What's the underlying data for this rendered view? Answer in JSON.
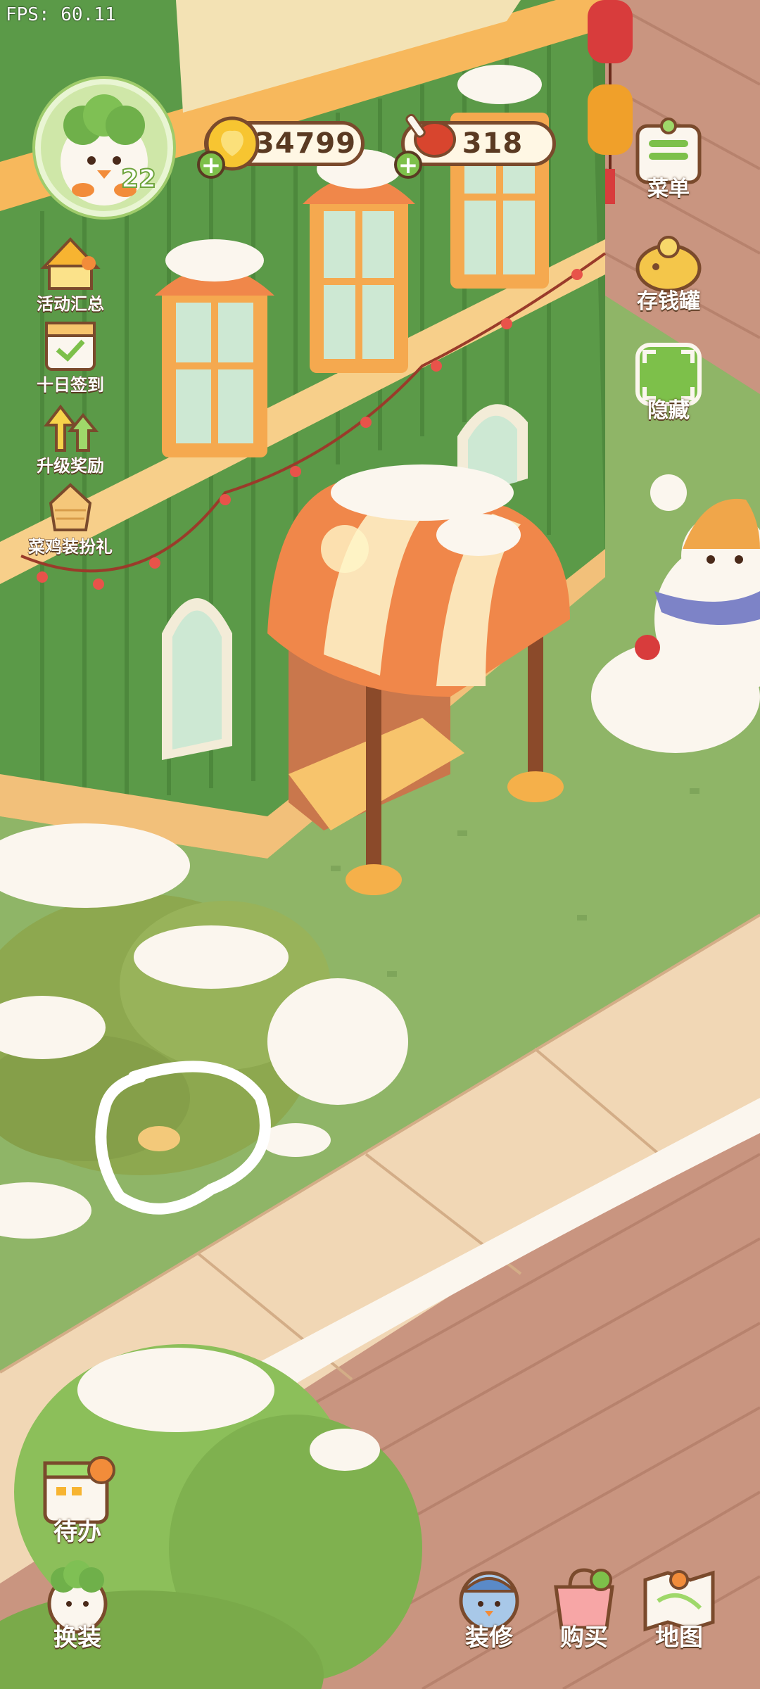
{
  "fps": "FPS: 60.11",
  "player": {
    "level": "22"
  },
  "resources": {
    "coins": "34799",
    "meat": "318"
  },
  "left_menu": [
    {
      "label": "活动汇总",
      "icon": "event-summary-icon"
    },
    {
      "label": "十日签到",
      "icon": "ten-day-checkin-icon"
    },
    {
      "label": "升级奖励",
      "icon": "level-up-reward-icon"
    },
    {
      "label": "菜鸡装扮礼",
      "icon": "dress-up-gift-icon"
    }
  ],
  "right_menu": [
    {
      "label": "菜单",
      "icon": "menu-list-icon"
    },
    {
      "label": "存钱罐",
      "icon": "piggy-bank-icon"
    },
    {
      "label": "隐藏",
      "icon": "hide-ui-icon"
    }
  ],
  "bottom_left": [
    {
      "label": "待办",
      "icon": "todo-calendar-icon"
    },
    {
      "label": "换装",
      "icon": "outfit-change-icon"
    }
  ],
  "bottom_right": [
    {
      "label": "装修",
      "icon": "decorate-icon"
    },
    {
      "label": "购买",
      "icon": "shop-icon"
    },
    {
      "label": "地图",
      "icon": "map-icon"
    }
  ],
  "colors": {
    "building_green": "#4f8a3e",
    "awning_orange": "#f0874a",
    "grass": "#8fb567",
    "brick": "#c99580",
    "snow": "#fbf6ee"
  }
}
